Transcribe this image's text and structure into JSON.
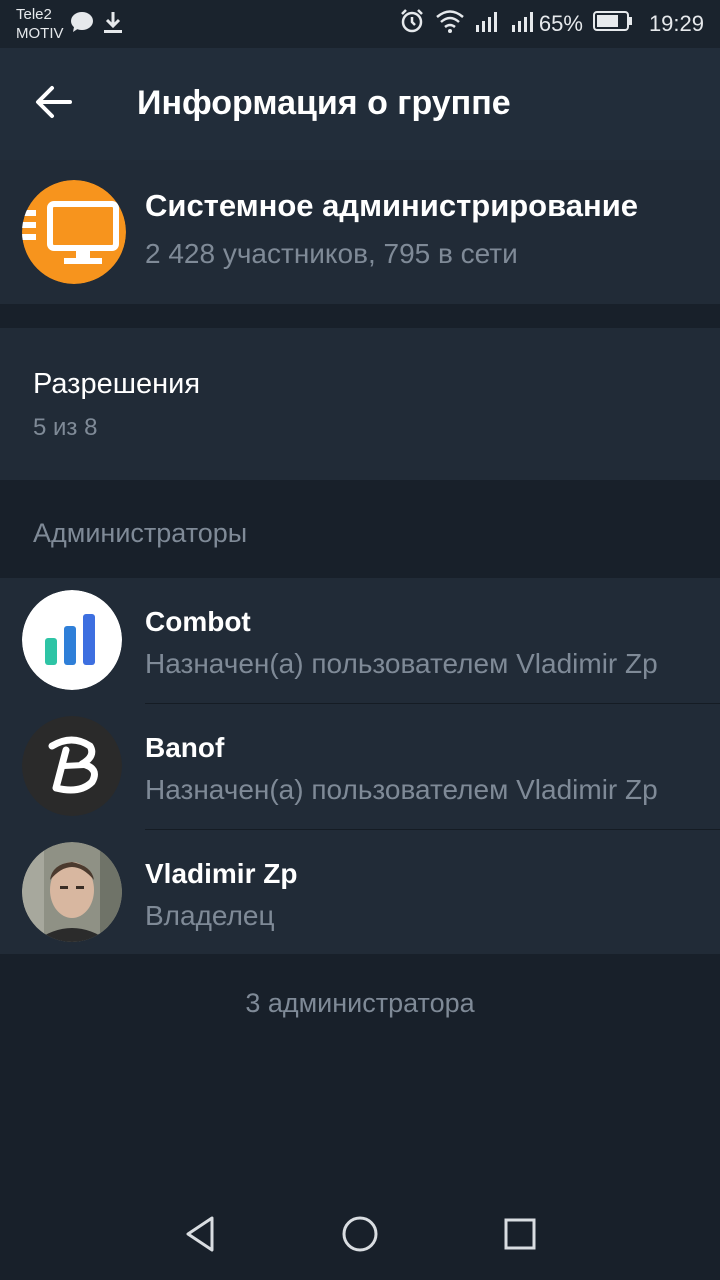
{
  "status_bar": {
    "carrier_line1": "Tele2",
    "carrier_line2": "MOTIV",
    "battery_percent": "65%",
    "time": "19:29",
    "icons": [
      "chat-bubble-icon",
      "download-icon",
      "alarm-icon",
      "wifi-icon",
      "signal-icon",
      "signal-icon",
      "battery-icon"
    ]
  },
  "toolbar": {
    "title": "Информация о группе",
    "back_icon": "arrow-left-icon"
  },
  "group": {
    "name": "Системное администрирование",
    "stats": "2 428 участников, 795 в сети",
    "avatar_icon": "monitor-icon",
    "avatar_color": "#f7941d"
  },
  "permissions": {
    "title": "Разрешения",
    "subtitle": "5 из 8"
  },
  "admins": {
    "header": "Администраторы",
    "items": [
      {
        "name": "Combot",
        "role": "Назначен(а) пользователем Vladimir Zp",
        "avatar_icon": "bar-chart-icon"
      },
      {
        "name": "Banof",
        "role": "Назначен(а) пользователем Vladimir Zp",
        "avatar_icon": "letter-b-icon"
      },
      {
        "name": "Vladimir Zp",
        "role": "Владелец",
        "avatar_icon": "user-photo"
      }
    ],
    "count_text": "3 администратора"
  },
  "nav_bar": {
    "icons": [
      "back-triangle-icon",
      "home-circle-icon",
      "recents-square-icon"
    ]
  },
  "colors": {
    "background": "#18202a",
    "surface": "#212b37",
    "toolbar": "#222d3a",
    "secondary_text": "#7f8a97",
    "accent_orange": "#f7941d",
    "combot_teal": "#2ec4a5",
    "combot_blue": "#3d6fe0"
  }
}
